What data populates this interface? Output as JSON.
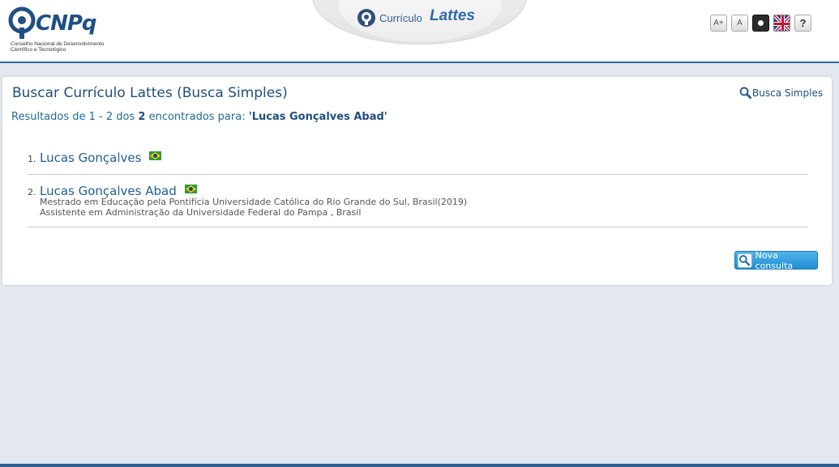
{
  "header": {
    "logo_text": "CNPq",
    "logo_sub": "Conselho Nacional de Desenvolvimento Científico e Tecnológico",
    "product_prefix": "Currículo",
    "product_name": "Lattes",
    "tools": {
      "font_increase": "A+",
      "font_reset": "A",
      "contrast_icon": "contrast-icon",
      "language_icon": "uk-flag-icon",
      "help": "?"
    }
  },
  "panel": {
    "title": "Buscar Currículo Lattes (Busca Simples)",
    "busca_link": "Busca Simples",
    "summary_prefix": "Resultados de 1 - 2 dos",
    "summary_count": "2",
    "summary_mid": "encontrados para:",
    "summary_query": "'Lucas Gonçalves Abad'",
    "results": [
      {
        "num": "1.",
        "name": "Lucas Gonçalves",
        "flag_icon": "brazil-flag-icon",
        "lines": []
      },
      {
        "num": "2.",
        "name": "Lucas Gonçalves Abad",
        "flag_icon": "brazil-flag-icon",
        "lines": [
          "Mestrado em Educação pela Pontifícia Universidade Católica do Rio Grande do Sul, Brasil(2019)",
          "Assistente em Administração da Universidade Federal do Pampa , Brasil"
        ]
      }
    ],
    "nova_button": "Nova consulta"
  },
  "colors": {
    "brand_blue": "#1e4f7c",
    "link_blue": "#1e5e99",
    "button_blue": "#1f8fd3"
  }
}
